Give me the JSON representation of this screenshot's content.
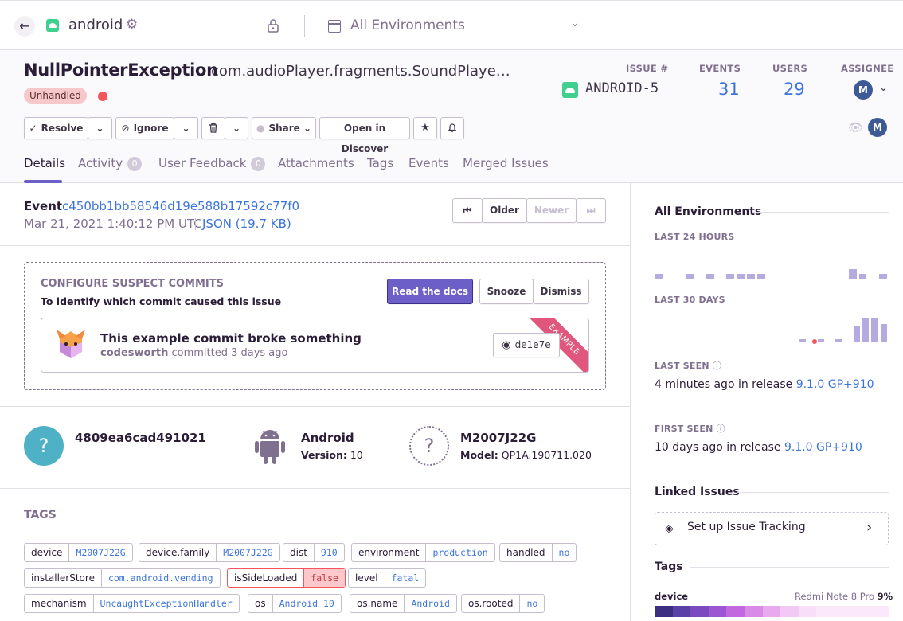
{
  "topbar": {
    "project": "android",
    "environment": "All Environments"
  },
  "issue": {
    "title": "NullPointerException",
    "culprit": "com.audioPlayer.fragments.SoundPlaye…",
    "badge": "Unhandled",
    "stats": {
      "issue_label": "ISSUE #",
      "issue_id": "ANDROID-5",
      "events_label": "EVENTS",
      "events": "31",
      "users_label": "USERS",
      "users": "29",
      "assignee_label": "ASSIGNEE",
      "assignee_initial": "M"
    },
    "seen_by_initial": "M"
  },
  "actions": {
    "resolve": "Resolve",
    "ignore": "Ignore",
    "share": "Share",
    "discover": "Open in Discover"
  },
  "tabs": [
    {
      "label": "Details"
    },
    {
      "label": "Activity",
      "count": "0"
    },
    {
      "label": "User Feedback",
      "count": "0"
    },
    {
      "label": "Attachments"
    },
    {
      "label": "Tags"
    },
    {
      "label": "Events"
    },
    {
      "label": "Merged Issues"
    }
  ],
  "event": {
    "label": "Event",
    "id": "c450bb1bb58546d19e588b17592c77f0",
    "date": "Mar 21, 2021 1:40:12 PM UTC",
    "json": "JSON (19.7 KB)",
    "older": "Older",
    "newer": "Newer"
  },
  "suspect": {
    "title": "CONFIGURE SUSPECT COMMITS",
    "subtitle": "To identify which commit caused this issue",
    "read_docs": "Read the docs",
    "snooze": "Snooze",
    "dismiss": "Dismiss",
    "commit_title": "This example commit broke something",
    "commit_author": "codesworth",
    "commit_meta": "committed 3 days ago",
    "commit_hash": "de1e7e",
    "ribbon": "EXAMPLE"
  },
  "context": {
    "user_id": "4809ea6cad491021",
    "os_name": "Android",
    "os_version_label": "Version:",
    "os_version": "10",
    "device_name": "M2007J22G",
    "device_model_label": "Model:",
    "device_model": "QP1A.190711.020"
  },
  "tags_heading": "TAGS",
  "tags": [
    {
      "k": "device",
      "v": "M2007J22G"
    },
    {
      "k": "device.family",
      "v": "M2007J22G"
    },
    {
      "k": "dist",
      "v": "910"
    },
    {
      "k": "environment",
      "v": "production"
    },
    {
      "k": "handled",
      "v": "no"
    },
    {
      "k": "installerStore",
      "v": "com.android.vending"
    },
    {
      "k": "isSideLoaded",
      "v": "false"
    },
    {
      "k": "level",
      "v": "fatal"
    },
    {
      "k": "mechanism",
      "v": "UncaughtExceptionHandler"
    },
    {
      "k": "os",
      "v": "Android 10"
    },
    {
      "k": "os.name",
      "v": "Android"
    },
    {
      "k": "os.rooted",
      "v": "no"
    }
  ],
  "sidebar": {
    "env_title": "All Environments",
    "last24_label": "LAST 24 HOURS",
    "last30_label": "LAST 30 DAYS",
    "last24_bars": [
      0.3,
      0,
      0,
      0.3,
      0,
      0.3,
      0,
      0.3,
      0.3,
      0.3,
      0.3,
      0,
      0,
      0,
      0,
      0,
      0,
      0,
      0,
      0.6,
      0.3,
      0,
      0.3
    ],
    "last30_bars": [
      0,
      0,
      0,
      0,
      0,
      0,
      0,
      0,
      0,
      0,
      0,
      0,
      0,
      0,
      0,
      0,
      0.1,
      0,
      0.1,
      0,
      0.1,
      0,
      0.6,
      0.9,
      0.9,
      0.7
    ],
    "last_seen_label": "LAST SEEN",
    "last_seen": "4 minutes ago",
    "in_release": "in release",
    "last_seen_release": "9.1.0 GP+910",
    "first_seen_label": "FIRST SEEN",
    "first_seen": "10 days ago",
    "first_seen_release": "9.1.0 GP+910",
    "linked_title": "Linked Issues",
    "tracking": "Set up Issue Tracking",
    "tags_title": "Tags",
    "tag_device": "device",
    "tag_device_top": "Redmi Note 8 Pro",
    "tag_device_pct": "9%",
    "heat_colors": [
      "#3c2e80",
      "#5b40a6",
      "#7a4bbf",
      "#9d56d1",
      "#c268de",
      "#d98ae6",
      "#e7aaee",
      "#f1c9f4",
      "#f8def9",
      "#fbe9fb"
    ]
  }
}
